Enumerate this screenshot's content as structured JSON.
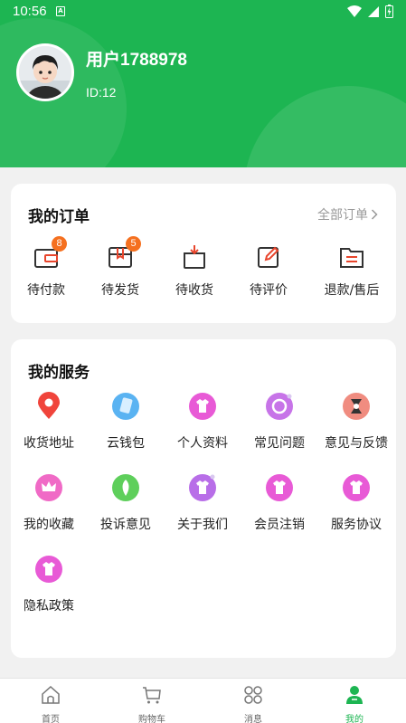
{
  "status_bar": {
    "time": "10:56",
    "sim_label": "A"
  },
  "profile": {
    "username": "用户1788978",
    "user_id": "ID:12"
  },
  "orders": {
    "title": "我的订单",
    "see_all": "全部订单",
    "items": [
      {
        "label": "待付款",
        "icon": "wallet-icon",
        "badge": "8"
      },
      {
        "label": "待发货",
        "icon": "package-icon",
        "badge": "5"
      },
      {
        "label": "待收货",
        "icon": "receive-box-icon"
      },
      {
        "label": "待评价",
        "icon": "edit-review-icon"
      },
      {
        "label": "退款/售后",
        "icon": "refund-folder-icon"
      }
    ]
  },
  "services": {
    "title": "我的服务",
    "items": [
      {
        "label": "收货地址",
        "icon": "location-pin-icon"
      },
      {
        "label": "云钱包",
        "icon": "cloud-wallet-icon"
      },
      {
        "label": "个人资料",
        "icon": "profile-shirt-icon"
      },
      {
        "label": "常见问题",
        "icon": "faq-icon"
      },
      {
        "label": "意见与反馈",
        "icon": "feedback-icon"
      },
      {
        "label": "我的收藏",
        "icon": "crown-favorite-icon"
      },
      {
        "label": "投诉意见",
        "icon": "complaint-icon"
      },
      {
        "label": "关于我们",
        "icon": "about-icon"
      },
      {
        "label": "会员注销",
        "icon": "member-cancel-icon"
      },
      {
        "label": "服务协议",
        "icon": "service-agreement-icon"
      },
      {
        "label": "隐私政策",
        "icon": "privacy-policy-icon"
      }
    ]
  },
  "bottom_nav": {
    "items": [
      {
        "label": "首页",
        "icon": "home-icon"
      },
      {
        "label": "购物车",
        "icon": "cart-icon"
      },
      {
        "label": "消息",
        "icon": "message-grid-icon"
      },
      {
        "label": "我的",
        "icon": "user-profile-icon",
        "active": true
      }
    ]
  },
  "colors": {
    "brand_green": "#1db552",
    "badge_orange": "#f5701f",
    "order_icon_stroke": "#333333",
    "order_icon_accent": "#e8452c"
  }
}
